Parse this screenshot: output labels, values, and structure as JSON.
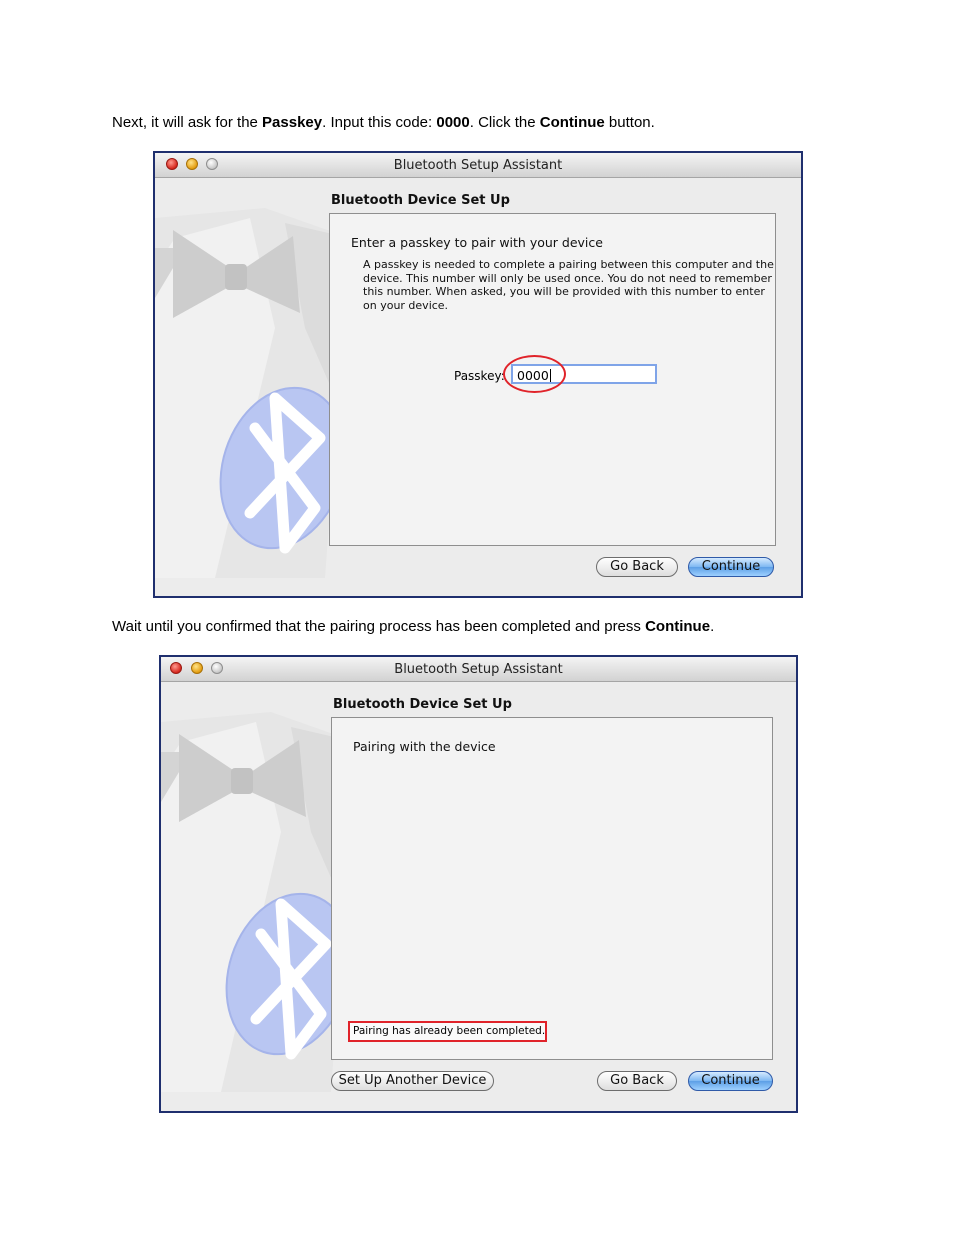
{
  "instruction1": {
    "pre": "Next, it will ask for the ",
    "b1": "Passkey",
    "mid1": ". Input this code: ",
    "b2": "0000",
    "mid2": ". Click the ",
    "b3": "Continue",
    "post": " button."
  },
  "window1": {
    "title": "Bluetooth Setup Assistant",
    "section_title": "Bluetooth Device Set Up",
    "panel_heading": "Enter a passkey to pair with your device",
    "description_lines": [
      "A passkey is needed to complete a pairing between this computer and the",
      "device. This number will only be used once. You do not need to remember",
      "this number. When asked, you will be provided with this number to enter",
      "on your device."
    ],
    "passkey_label": "Passkey:",
    "passkey_value": "0000",
    "go_back": "Go Back",
    "continue": "Continue"
  },
  "instruction2": {
    "pre": "Wait until you confirmed that the pairing process has been completed and press ",
    "b1": "Continue",
    "post": "."
  },
  "window2": {
    "title": "Bluetooth Setup Assistant",
    "section_title": "Bluetooth Device Set Up",
    "panel_heading": "Pairing with the device",
    "status": "Pairing has already been completed.",
    "setup_another": "Set Up Another Device",
    "go_back": "Go Back",
    "continue": "Continue"
  },
  "colors": {
    "highlight": "#e0232a",
    "window_border": "#1f2f6e",
    "bluetooth_blue": "#b9c6f2"
  },
  "icons": [
    "close-light",
    "minimize-light",
    "zoom-light",
    "tuxedo-bowtie-art",
    "bluetooth-logo-icon"
  ]
}
